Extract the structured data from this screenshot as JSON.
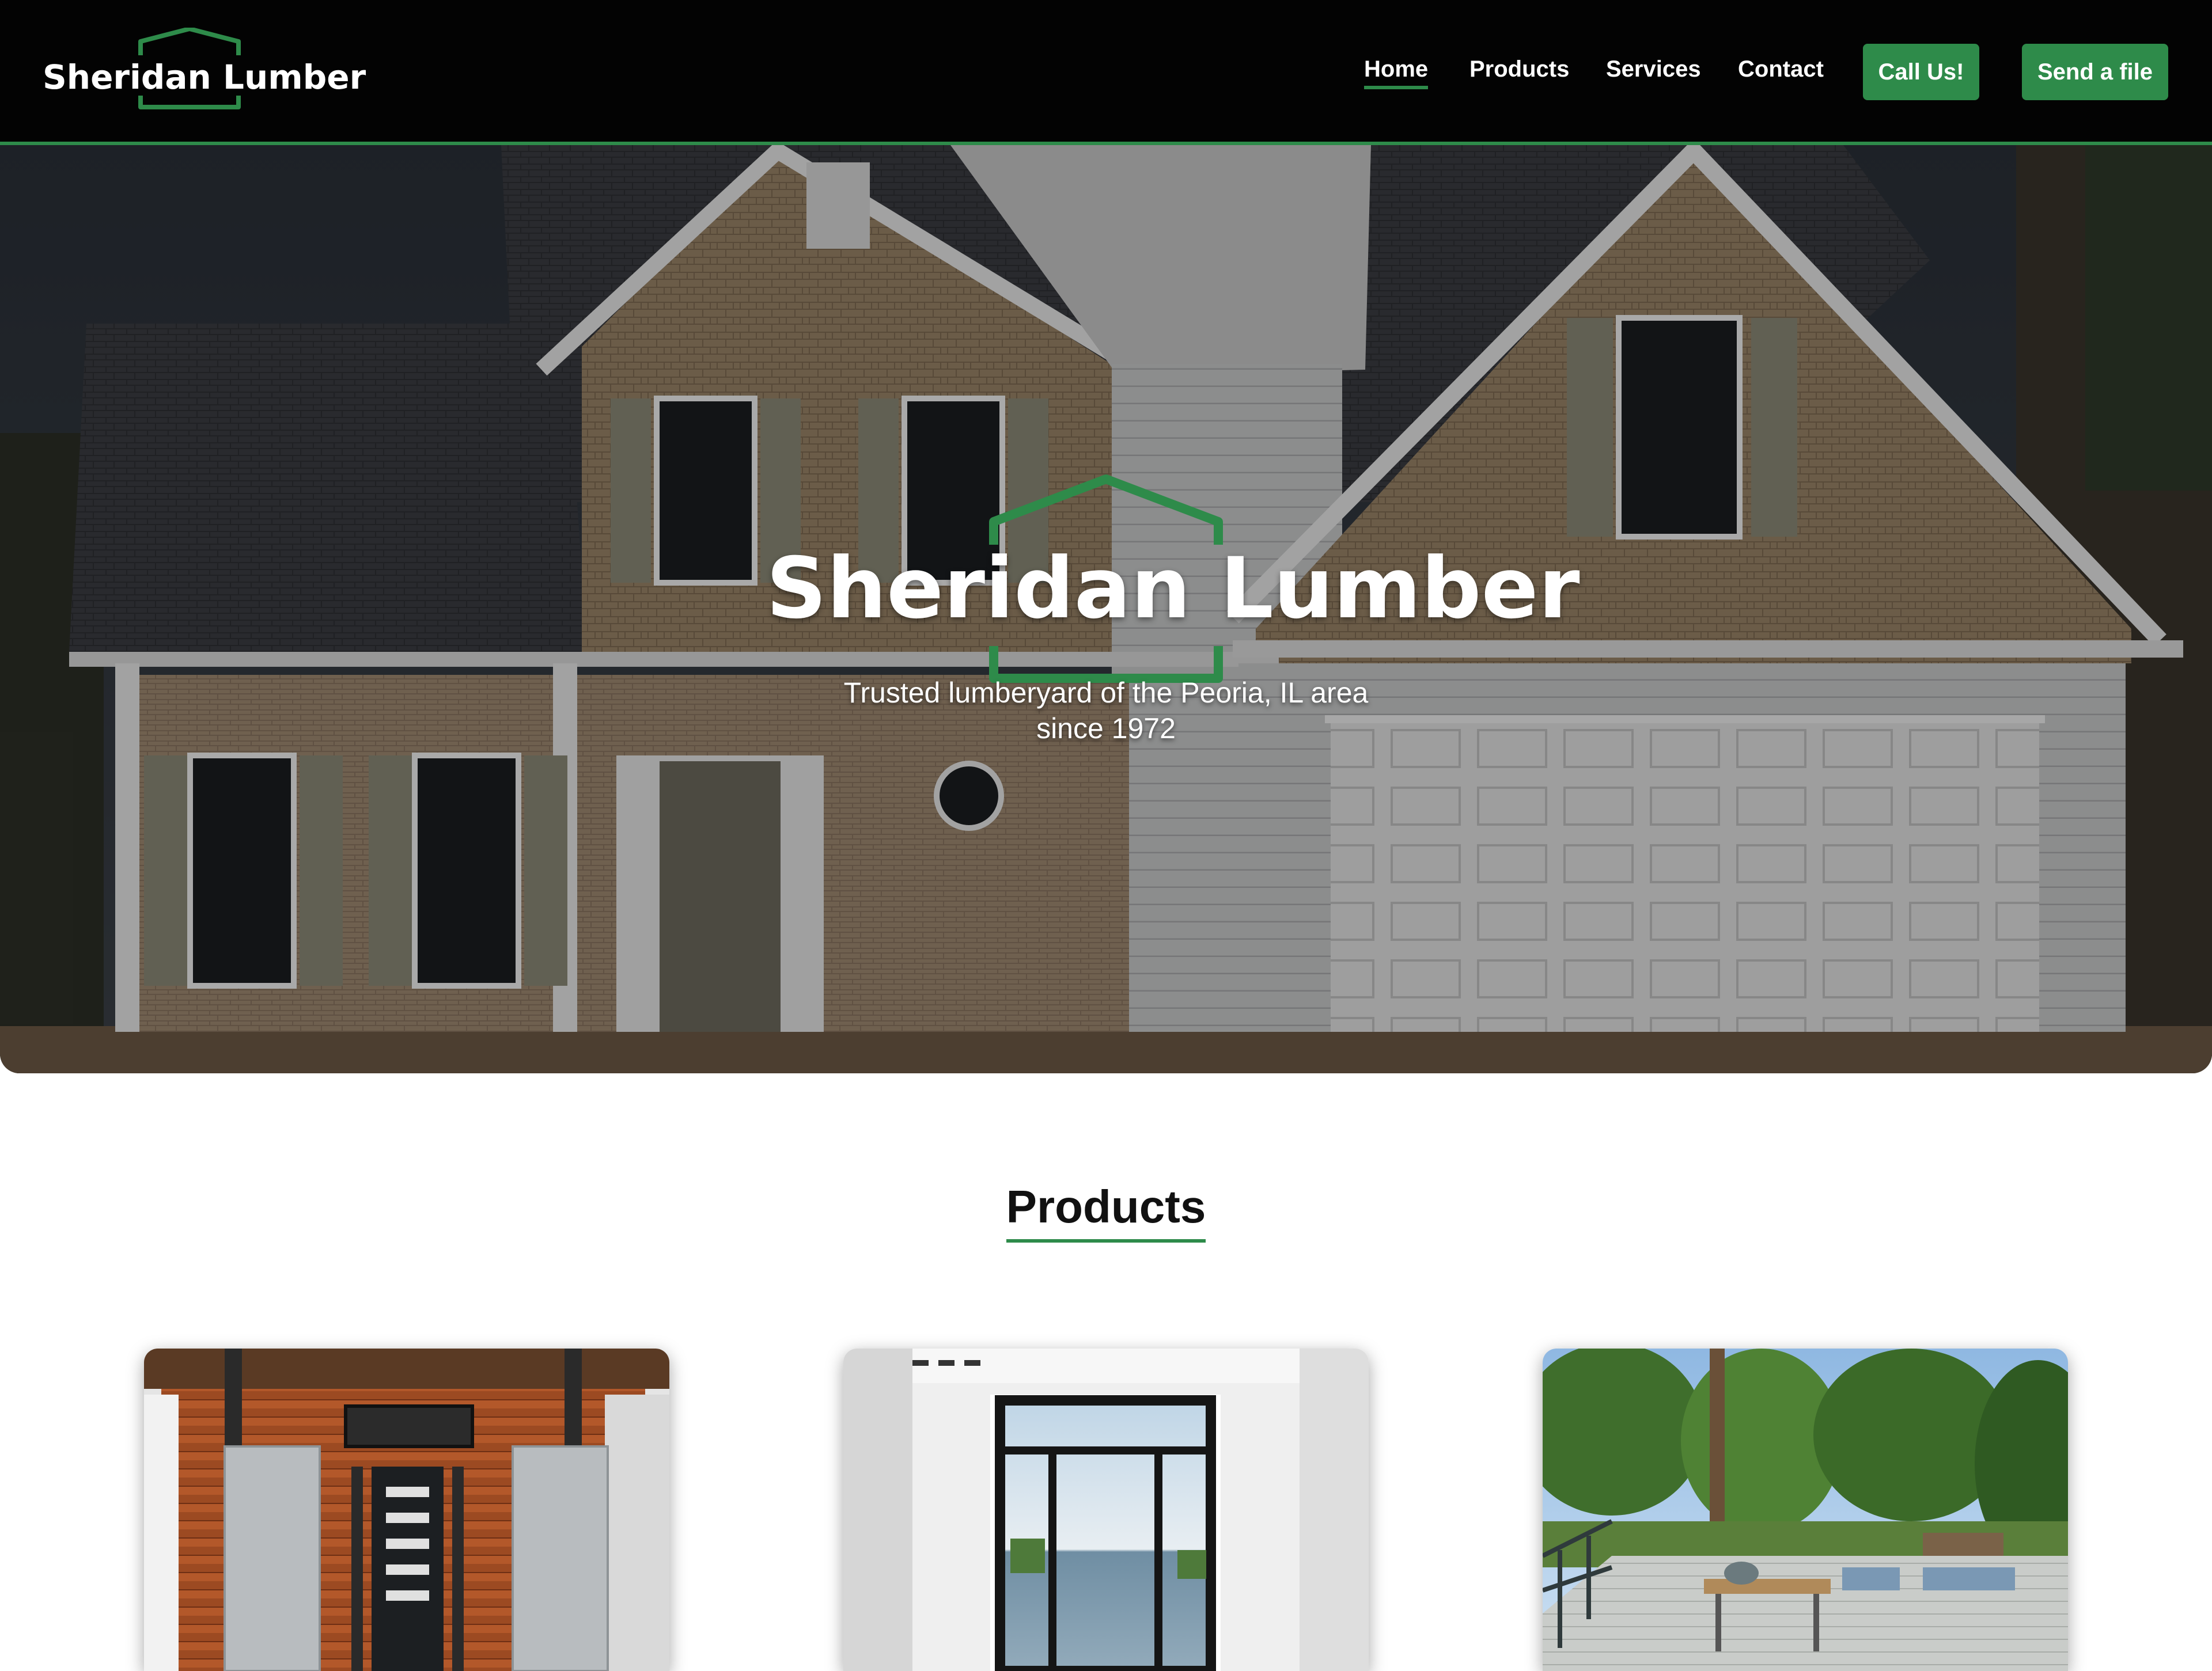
{
  "brand": {
    "name": "Sheridan Lumber",
    "accent_color": "#2e8b4a",
    "logo_icon": "house-outline-icon"
  },
  "nav": {
    "links": [
      {
        "label": "Home",
        "active": true
      },
      {
        "label": "Products",
        "active": false
      },
      {
        "label": "Services",
        "active": false
      },
      {
        "label": "Contact",
        "active": false
      }
    ],
    "buttons": [
      {
        "label": "Call Us!"
      },
      {
        "label": "Send a file"
      }
    ]
  },
  "hero": {
    "title": "Sheridan Lumber",
    "subtitle_line1": "Trusted lumberyard of the Peoria, IL area",
    "subtitle_line2": "since 1972"
  },
  "products": {
    "heading": "Products"
  }
}
